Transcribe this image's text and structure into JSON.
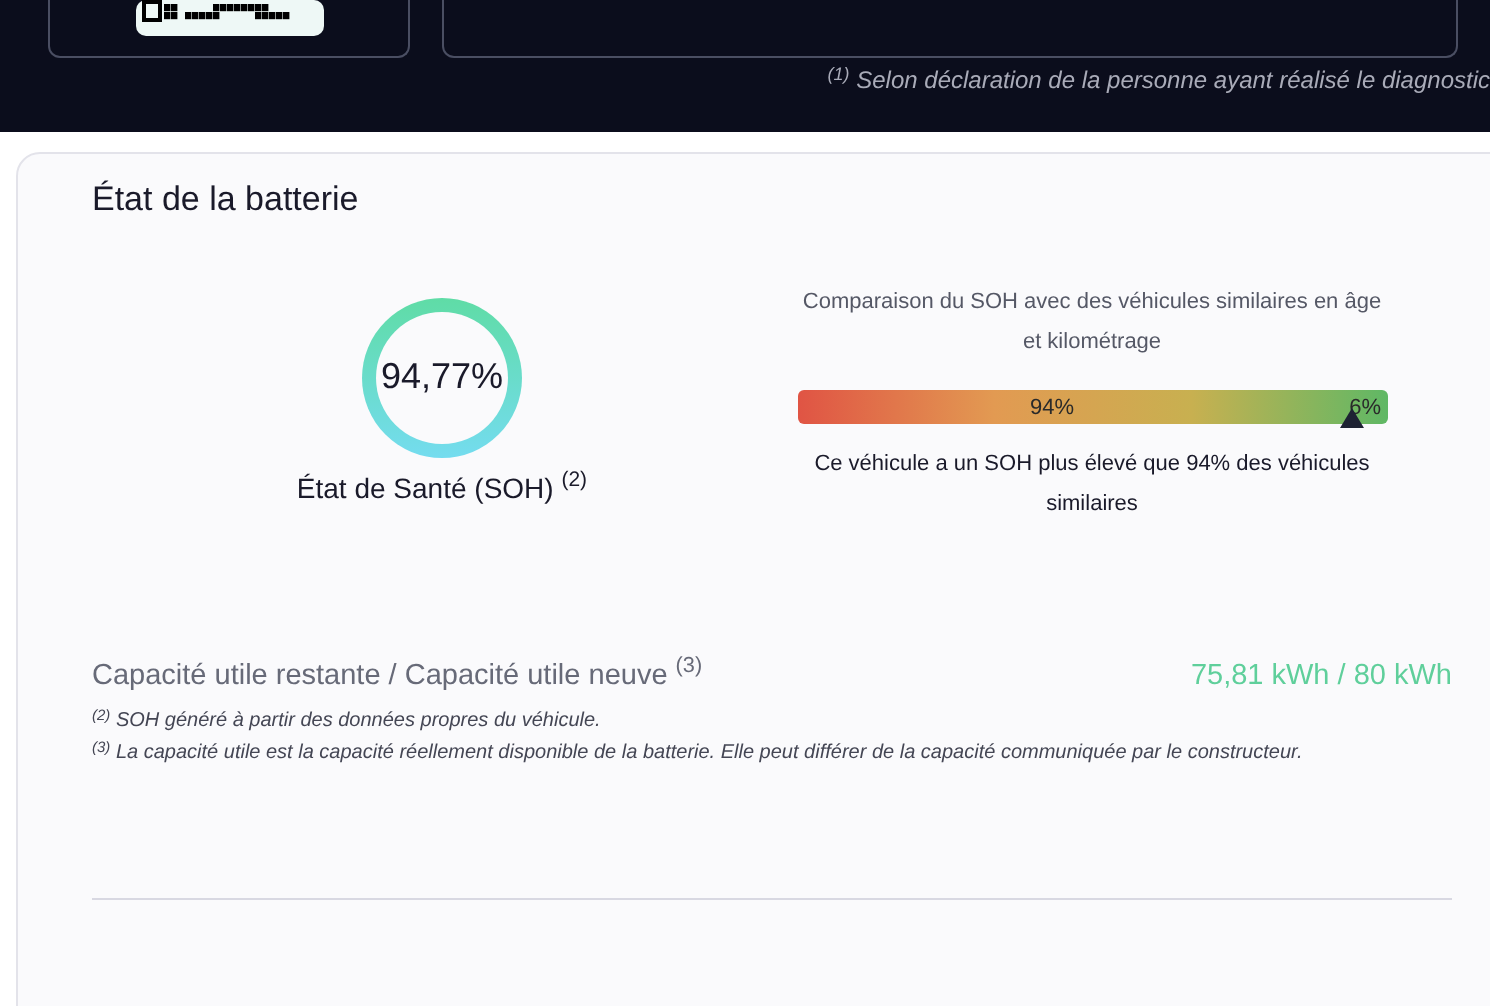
{
  "banner": {
    "footnote": "$^{(1)}$ Selon déclaration de la personne ayant réalisé le diagnostic"
  },
  "battery": {
    "title": "État de la batterie",
    "soh": {
      "value": "94,77%",
      "label": "État de Santé (SOH) $^{(2)}$"
    },
    "comparison": {
      "title": "Comparaison du SOH avec des véhicules similaires en âge et kilométrage",
      "level": 0.94,
      "lower_label": "94%",
      "higher_label": "6%",
      "summary": "Ce véhicule a un SOH plus élevé que 94% des véhicules similaires"
    },
    "capacity": {
      "label": "Capacité utile restante / Capacité utile neuve $^{(3)}$",
      "value": "75,81 kWh / 80 kWh"
    },
    "notes": [
      "$^{(2)}$ SOH généré à partir des données propres du véhicule.",
      "$^{(3)}$ La capacité utile est la capacité réellement disponible de la batterie. Elle peut différer de la capacité communiquée par le constructeur."
    ]
  }
}
